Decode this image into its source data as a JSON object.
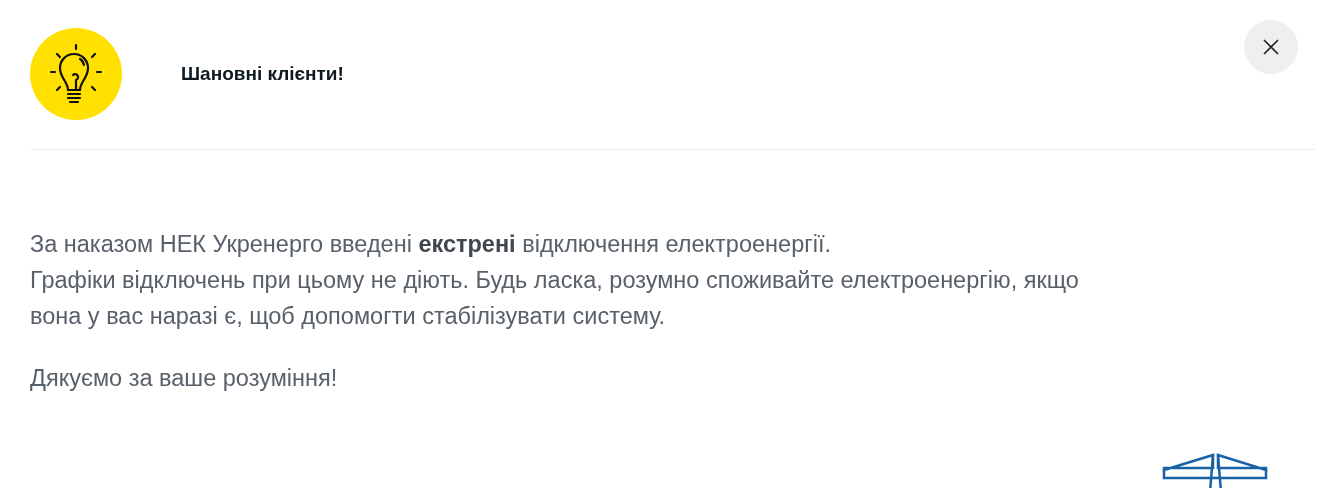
{
  "header": {
    "title": "Шановні клієнти!"
  },
  "message": {
    "paragraphs": [
      {
        "lines": [
          "За наказом НЕК Укренерго введені **екстрені** відключення електроенергії.",
          "Графіки відключень при цьому не діють.  Будь ласка, розумно споживайте електроенергію, якщо",
          "вона у вас наразі є, щоб допомогти стабілізувати систему."
        ]
      },
      {
        "lines": [
          "Дякуємо за ваше розуміння!"
        ]
      }
    ]
  }
}
